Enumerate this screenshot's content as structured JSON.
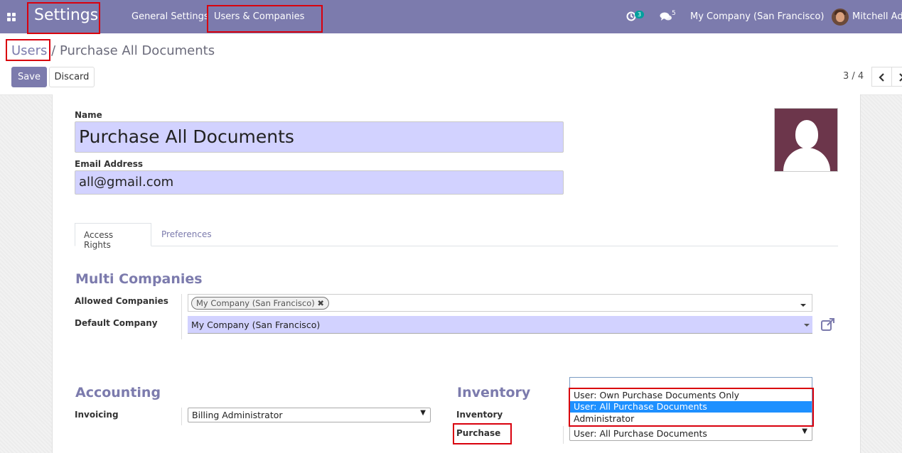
{
  "navbar": {
    "app_title": "Settings",
    "menu": [
      {
        "label": "General Settings"
      },
      {
        "label": "Users & Companies"
      }
    ],
    "activity_count": "3",
    "message_count": "5",
    "company_switcher": "My Company (San Francisco)",
    "user_name": "Mitchell Adm",
    "bg_color": "#7c7bad"
  },
  "breadcrumb": {
    "parent": "Users",
    "separator": "/",
    "current": "Purchase All Documents"
  },
  "actions": {
    "save_label": "Save",
    "discard_label": "Discard"
  },
  "pager": {
    "value": "3 / 4"
  },
  "form": {
    "name_label": "Name",
    "name_value": "Purchase All Documents",
    "email_label": "Email Address",
    "email_value": "all@gmail.com",
    "tabs": [
      {
        "label": "Access Rights",
        "active": true
      },
      {
        "label": "Preferences",
        "active": false
      }
    ],
    "multi_companies": {
      "title": "Multi Companies",
      "allowed_label": "Allowed Companies",
      "allowed_tags": [
        "My Company (San Francisco)"
      ],
      "default_label": "Default Company",
      "default_value": "My Company (San Francisco)"
    },
    "accounting": {
      "title": "Accounting",
      "invoicing_label": "Invoicing",
      "invoicing_value": "Billing Administrator"
    },
    "inventory": {
      "title": "Inventory",
      "inventory_label": "Inventory",
      "purchase_label": "Purchase",
      "purchase_value": "User: All Purchase Documents",
      "dropdown_options": [
        {
          "label": "User: Own Purchase Documents Only",
          "selected": false
        },
        {
          "label": "User: All Purchase Documents",
          "selected": true
        },
        {
          "label": "Administrator",
          "selected": false
        }
      ]
    }
  }
}
